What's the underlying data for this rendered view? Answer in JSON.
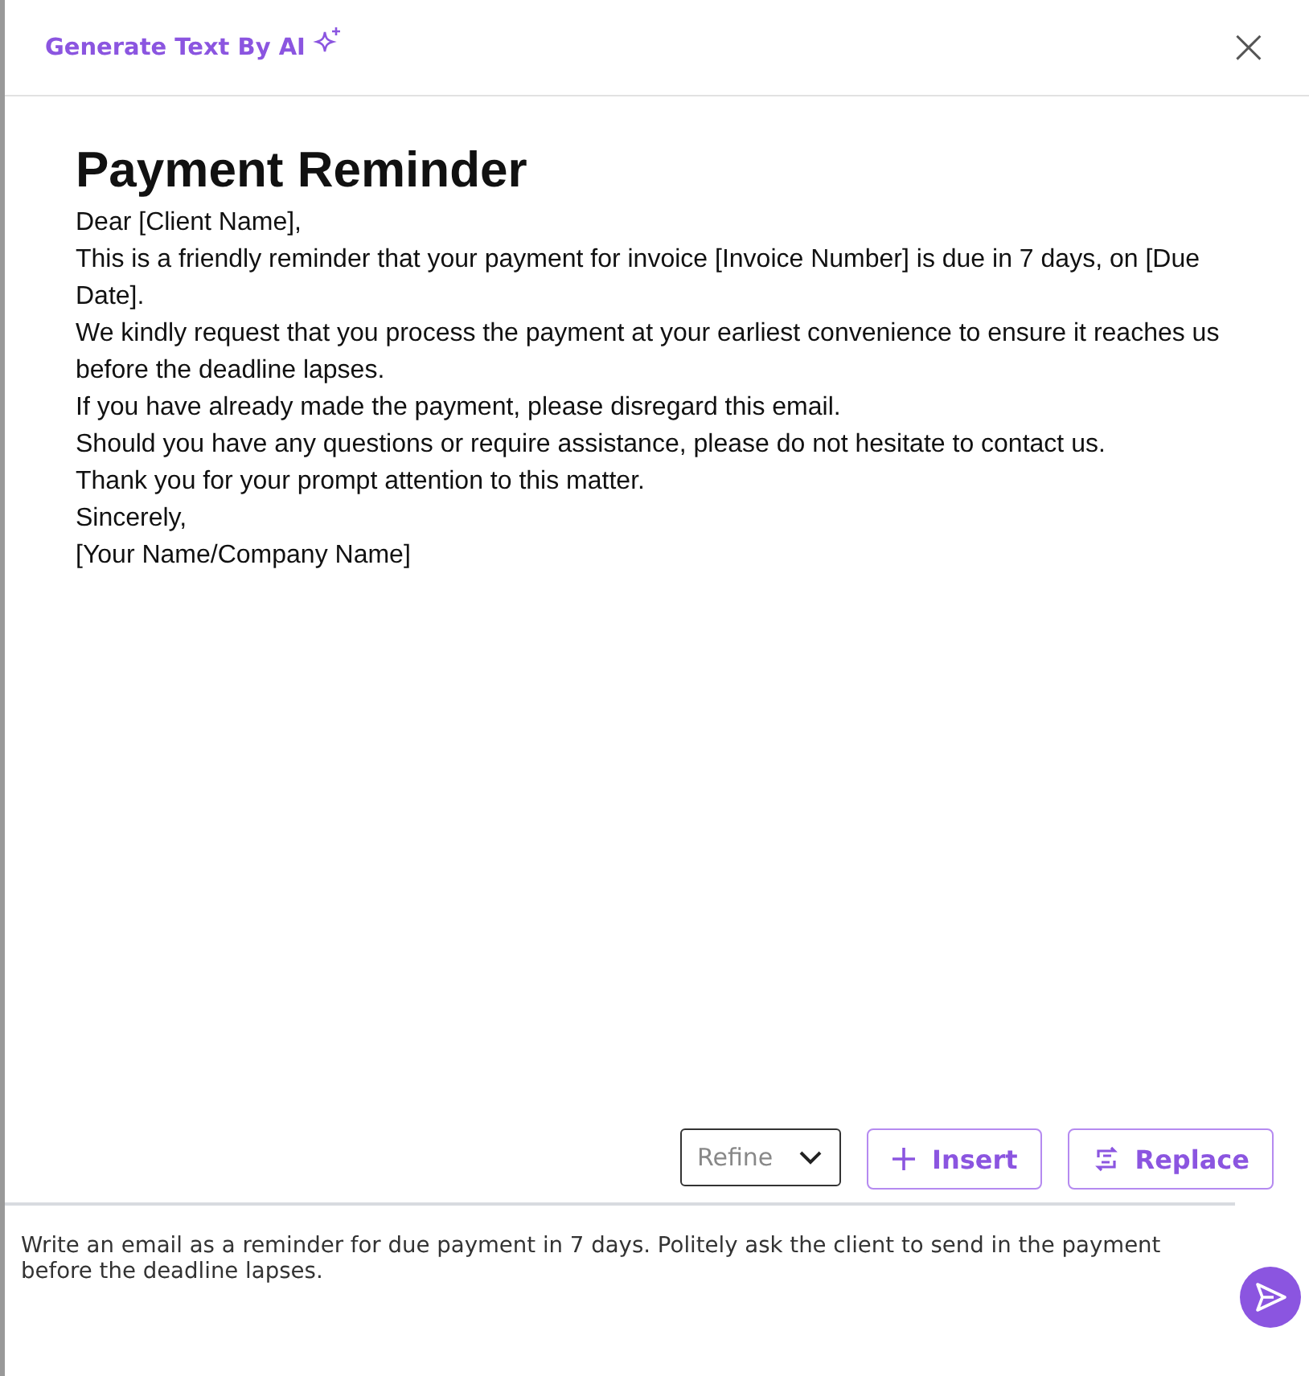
{
  "dialog": {
    "title": "Generate Text By AI",
    "close_label": "×"
  },
  "document": {
    "heading": "Payment Reminder",
    "paragraphs": [
      "Dear [Client Name],",
      "This is a friendly reminder that your payment for invoice [Invoice Number] is due in 7 days, on [Due Date].",
      "We kindly request that you process the payment at your earliest convenience to ensure it reaches us before the deadline lapses.",
      "If you have already made the payment, please disregard this email.",
      "Should you have any questions or require assistance, please do not hesitate to contact us.",
      "Thank you for your prompt attention to this matter.",
      "Sincerely,",
      "[Your Name/Company Name]"
    ]
  },
  "actions": {
    "refine": {
      "placeholder": "Refine"
    },
    "buttons": [
      {
        "kind": "insert",
        "label": "Insert"
      },
      {
        "kind": "replace",
        "label": "Replace"
      }
    ]
  },
  "prompt": {
    "value": "Write an email as a reminder for due payment in 7 days. Politely ask the client to send in the payment before the deadline lapses."
  }
}
